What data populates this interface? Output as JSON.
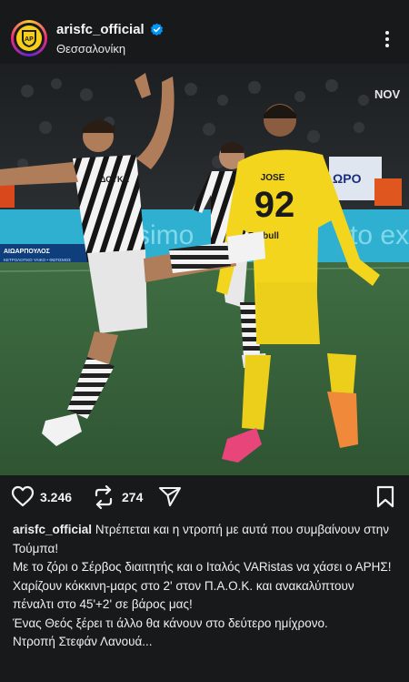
{
  "header": {
    "username": "arisfc_official",
    "location": "Θεσσαλονίκη",
    "avatar_logo_text": "AΡ"
  },
  "photo": {
    "broadcaster_watermark": "NOV",
    "shirt_number": "92",
    "shirt_name": "JOSE",
    "sponsor_front": "Betbull",
    "sponsor_opponent": "ΔΟΥΚΑ",
    "board_left": "ΑΙΩΑΡΠΟΥΛΟΣ",
    "board_left_sub": "ΚΕΤΡΟΛΟΓΙΚΟ ΥΛΙΚΟ • ΦΩΤΙΣΜΟΣ",
    "board_center": "simo",
    "board_right": "to ex",
    "board_upper": "ΩΡΟ"
  },
  "actions": {
    "likes": "3.246",
    "reposts": "274"
  },
  "caption": {
    "username": "arisfc_official",
    "lines": [
      "Ντρέπεται και η ντροπή με αυτά που συμβαίνουν στην Τούμπα!",
      "Με το ζόρι ο Σέρβος διαιτητής και ο Ιταλός VARistas να χάσει ο ΑΡΗΣ!",
      "Χαρίζουν κόκκινη-μαρς στο 2' στον Π.Α.Ο.Κ. και ανακαλύπτουν πέναλτι στο 45'+2' σε βάρος μας!",
      "Ένας Θεός ξέρει τι άλλο θα κάνουν στο δεύτερο ημίχρονο.",
      "Ντροπή Στεφάν Λανουά..."
    ]
  },
  "colors": {
    "background": "#18191b",
    "aris_yellow": "#f2d51c",
    "verified_blue": "#0095f6",
    "pitch_green": "#3d6a3f"
  }
}
